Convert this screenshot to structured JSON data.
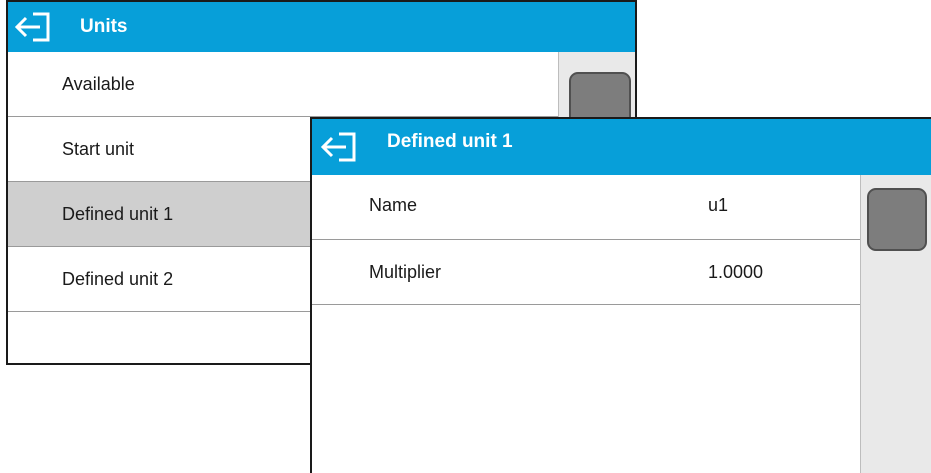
{
  "units_window": {
    "title": "Units",
    "back_icon": "exit-arrow-icon",
    "items": [
      {
        "label": "Available",
        "selected": false
      },
      {
        "label": "Start unit",
        "selected": false
      },
      {
        "label": "Defined unit 1",
        "selected": true
      },
      {
        "label": "Defined unit 2",
        "selected": false
      }
    ]
  },
  "defined_unit_window": {
    "title": "Defined unit 1",
    "back_icon": "exit-arrow-icon",
    "rows": [
      {
        "name": "Name",
        "value": "u1"
      },
      {
        "name": "Multiplier",
        "value": "1.0000"
      }
    ]
  },
  "colors": {
    "header": "#079fd9",
    "selected_row": "#cfcfcf",
    "scroll_thumb": "#7d7d7d"
  }
}
